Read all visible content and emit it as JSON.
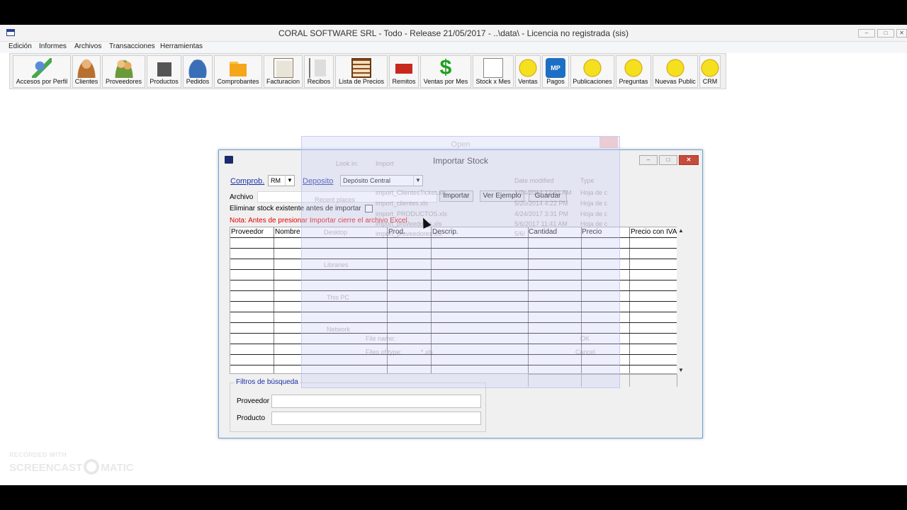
{
  "window": {
    "title": "CORAL SOFTWARE SRL - Todo -  Release 21/05/2017 - ..\\data\\ - Licencia no registrada (sis)"
  },
  "menu": [
    "Edición",
    "Informes",
    "Archivos",
    "Transacciones",
    "Herramientas"
  ],
  "toolbar": [
    {
      "label": "Accesos por Perfil",
      "icon": "key-users-icon"
    },
    {
      "label": "Clientes",
      "icon": "person-icon"
    },
    {
      "label": "Proveedores",
      "icon": "people-icon"
    },
    {
      "label": "Productos",
      "icon": "products-icon"
    },
    {
      "label": "Pedidos",
      "icon": "basket-icon"
    },
    {
      "label": "Comprobantes",
      "icon": "folder-icon"
    },
    {
      "label": "Facturacion",
      "icon": "percent-icon"
    },
    {
      "label": "Recibos",
      "icon": "receipt-icon"
    },
    {
      "label": "Lista de Precios",
      "icon": "abacus-icon"
    },
    {
      "label": "Remitos",
      "icon": "truck-icon"
    },
    {
      "label": "Ventas por Mes",
      "icon": "dollar-icon"
    },
    {
      "label": "Stock x Mes",
      "icon": "chart-icon"
    },
    {
      "label": "Ventas",
      "icon": "yellow-handshake-icon"
    },
    {
      "label": "Pagos",
      "icon": "mp-icon",
      "badge": "MP"
    },
    {
      "label": "Publicaciones",
      "icon": "yellow-handshake-icon"
    },
    {
      "label": "Preguntas",
      "icon": "yellow-handshake-icon"
    },
    {
      "label": "Nuevas Public",
      "icon": "yellow-handshake-icon"
    },
    {
      "label": "CRM",
      "icon": "yellow-handshake-icon"
    }
  ],
  "dialog": {
    "title": "Importar Stock",
    "comprob_label": "Comprob.",
    "comprob_value": "RM",
    "deposito_label": "Deposito",
    "deposito_value": "Depósito Central",
    "archivo_label": "Archivo",
    "importar_button": "Importar",
    "ver_ejemplo_button": "Ver Ejemplo",
    "guardar_button": "Guardar",
    "eliminar_label": "Eliminar stock existente antes de importar",
    "note": "Nota: Antes de presionar Importar cierre el archivo Excel.",
    "columns": [
      "Proveedor",
      "Nombre",
      "Prod.",
      "Descrip.",
      "Cantidad",
      "Precio",
      "Precio con IVA"
    ],
    "filters_title": "Filtros de búsqueda",
    "proveedor_label": "Proveedor",
    "producto_label": "Producto"
  },
  "ghost_open_dialog": {
    "title": "Open",
    "look_in_label": "Look in:",
    "look_in_value": "Import",
    "col_date": "Date modified",
    "col_type": "Type",
    "files": [
      {
        "name": "import_ClientesTicket.xls",
        "date": "1/24/2014 12:31 AM",
        "type": "Hoja de c"
      },
      {
        "name": "import_clientes.xls",
        "date": "5/20/2014 4:22 PM",
        "type": "Hoja de c"
      },
      {
        "name": "import_PRODUCTOS.xls",
        "date": "4/24/2017 3:31 PM",
        "type": "Hoja de c"
      },
      {
        "name": "import_proveedores.xls",
        "date": "5/6/2017 11:41 AM",
        "type": "Hoja de c"
      },
      {
        "name": "import_proveedores.xls",
        "date": "5/6/",
        "type": ""
      }
    ],
    "places": [
      "Recent places",
      "Desktop",
      "Libraries",
      "This PC",
      "Network"
    ],
    "file_name_label": "File name:",
    "files_of_type_label": "Files of type:",
    "files_of_type_value": "*.xls",
    "ok_button": "OK",
    "cancel_button": "Cancel"
  },
  "watermark": {
    "line1": "RECORDED WITH",
    "line2a": "SCREENCAST",
    "line2b": "MATIC"
  }
}
